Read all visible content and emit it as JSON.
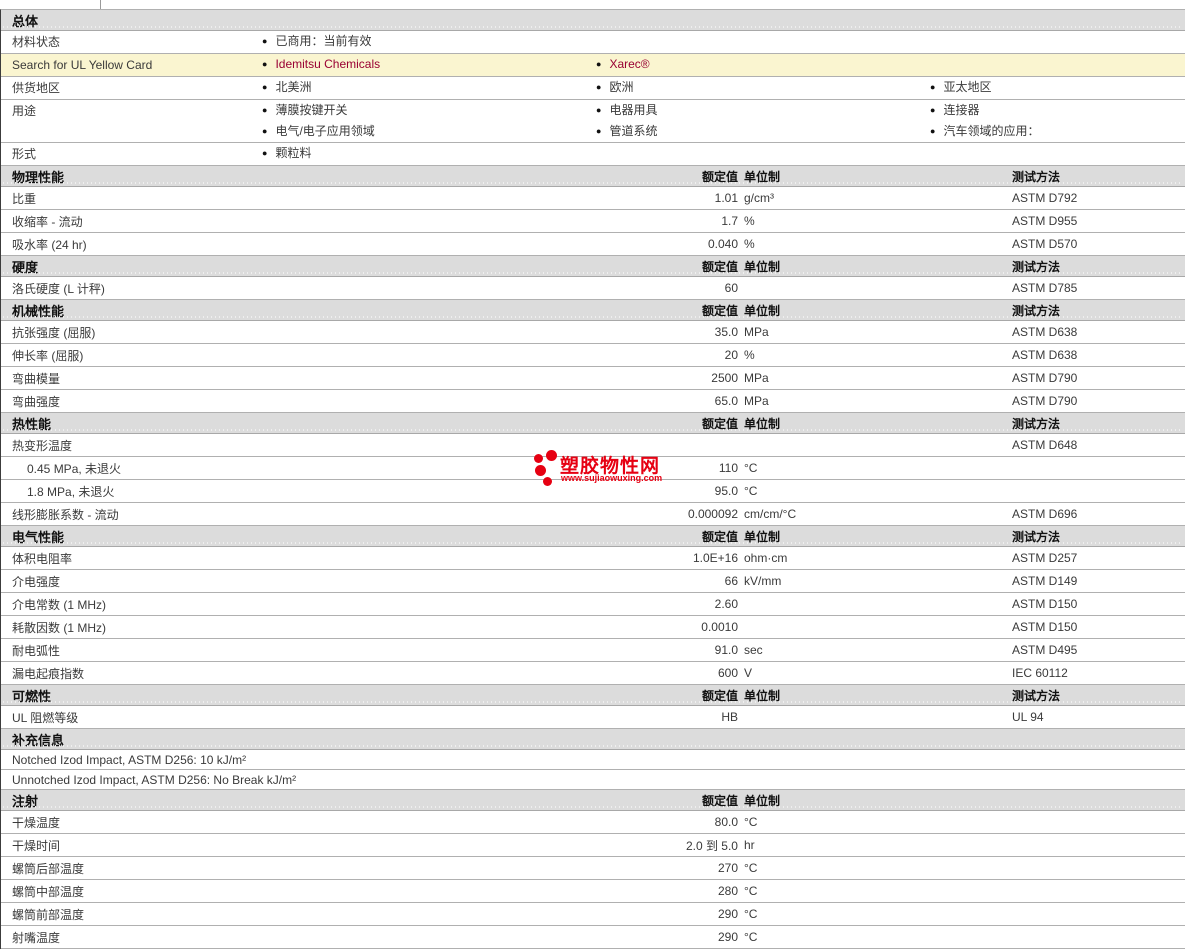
{
  "colors": {
    "section_header_bg": "#dcdcdc",
    "row_border": "#b0b0b0",
    "highlight_row_bg": "#faf5d0",
    "link_red": "#990033",
    "logo_red": "#e60012",
    "text": "#3a3a3a"
  },
  "column_headers": {
    "rated": "额定值",
    "unit": "单位制",
    "method": "测试方法"
  },
  "logo": {
    "site_name": "塑胶物性网",
    "site_url": "www.sujiaowuxing.com"
  },
  "general": {
    "title": "总体",
    "rows": [
      {
        "label": "材料状态",
        "highlight": false,
        "link_style": false,
        "cols": [
          [
            "已商用：当前有效"
          ],
          [],
          []
        ]
      },
      {
        "label": "Search for UL Yellow Card",
        "highlight": true,
        "link_style": true,
        "cols": [
          [
            "Idemitsu Chemicals"
          ],
          [
            "Xarec®"
          ],
          []
        ]
      },
      {
        "label": "供货地区",
        "highlight": false,
        "link_style": false,
        "cols": [
          [
            "北美洲"
          ],
          [
            "欧洲"
          ],
          [
            "亚太地区"
          ]
        ]
      },
      {
        "label": "用途",
        "highlight": false,
        "link_style": false,
        "cols": [
          [
            "薄膜按键开关",
            "电气/电子应用领域"
          ],
          [
            "电器用具",
            "管道系统"
          ],
          [
            "连接器",
            "汽车领域的应用："
          ]
        ]
      },
      {
        "label": "形式",
        "highlight": false,
        "link_style": false,
        "cols": [
          [
            "颗粒料"
          ],
          [],
          []
        ]
      }
    ]
  },
  "property_sections": [
    {
      "title": "物理性能",
      "columns": "full",
      "rows": [
        {
          "label": "比重",
          "value": "1.01",
          "unit": "g/cm³",
          "method": "ASTM D792"
        },
        {
          "label": "收缩率 - 流动",
          "value": "1.7",
          "unit": "%",
          "method": "ASTM D955"
        },
        {
          "label": "吸水率 (24 hr)",
          "value": "0.040",
          "unit": "%",
          "method": "ASTM D570"
        }
      ]
    },
    {
      "title": "硬度",
      "columns": "full",
      "rows": [
        {
          "label": "洛氏硬度 (L 计秤)",
          "value": "60",
          "unit": "",
          "method": "ASTM D785"
        }
      ]
    },
    {
      "title": "机械性能",
      "columns": "full",
      "rows": [
        {
          "label": "抗张强度 (屈服)",
          "value": "35.0",
          "unit": "MPa",
          "method": "ASTM D638"
        },
        {
          "label": "伸长率 (屈服)",
          "value": "20",
          "unit": "%",
          "method": "ASTM D638"
        },
        {
          "label": "弯曲模量",
          "value": "2500",
          "unit": "MPa",
          "method": "ASTM D790"
        },
        {
          "label": "弯曲强度",
          "value": "65.0",
          "unit": "MPa",
          "method": "ASTM D790"
        }
      ]
    },
    {
      "title": "热性能",
      "columns": "full",
      "rows": [
        {
          "label": "热变形温度",
          "value": "",
          "unit": "",
          "method": "ASTM D648"
        },
        {
          "label": "0.45 MPa, 未退火",
          "indent": true,
          "value": "110",
          "unit": "°C",
          "method": ""
        },
        {
          "label": "1.8 MPa, 未退火",
          "indent": true,
          "value": "95.0",
          "unit": "°C",
          "method": ""
        },
        {
          "label": "线形膨胀系数 - 流动",
          "value": "0.000092",
          "unit": "cm/cm/°C",
          "method": "ASTM D696"
        }
      ]
    },
    {
      "title": "电气性能",
      "columns": "full",
      "rows": [
        {
          "label": "体积电阻率",
          "value": "1.0E+16",
          "unit": "ohm·cm",
          "method": "ASTM D257"
        },
        {
          "label": "介电强度",
          "value": "66",
          "unit": "kV/mm",
          "method": "ASTM D149"
        },
        {
          "label": "介电常数 (1 MHz)",
          "value": "2.60",
          "unit": "",
          "method": "ASTM D150"
        },
        {
          "label": "耗散因数 (1 MHz)",
          "value": "0.0010",
          "unit": "",
          "method": "ASTM D150"
        },
        {
          "label": "耐电弧性",
          "value": "91.0",
          "unit": "sec",
          "method": "ASTM D495"
        },
        {
          "label": "漏电起痕指数",
          "value": "600",
          "unit": "V",
          "method": "IEC 60112"
        }
      ]
    },
    {
      "title": "可燃性",
      "columns": "full",
      "rows": [
        {
          "label": "UL 阻燃等级",
          "value": "HB",
          "unit": "",
          "method": "UL 94"
        }
      ]
    },
    {
      "title": "补充信息",
      "columns": "none",
      "notes": [
        "Notched Izod Impact, ASTM D256: 10 kJ/m²",
        "Unnotched Izod Impact, ASTM D256: No Break kJ/m²"
      ]
    },
    {
      "title": "注射",
      "columns": "value_only",
      "rows": [
        {
          "label": "干燥温度",
          "value": "80.0",
          "unit": "°C",
          "method": ""
        },
        {
          "label": "干燥时间",
          "value": "2.0 到  5.0",
          "unit": "hr",
          "method": ""
        },
        {
          "label": "螺筒后部温度",
          "value": "270",
          "unit": "°C",
          "method": ""
        },
        {
          "label": "螺筒中部温度",
          "value": "280",
          "unit": "°C",
          "method": ""
        },
        {
          "label": "螺筒前部温度",
          "value": "290",
          "unit": "°C",
          "method": ""
        },
        {
          "label": "射嘴温度",
          "value": "290",
          "unit": "°C",
          "method": ""
        }
      ]
    }
  ]
}
